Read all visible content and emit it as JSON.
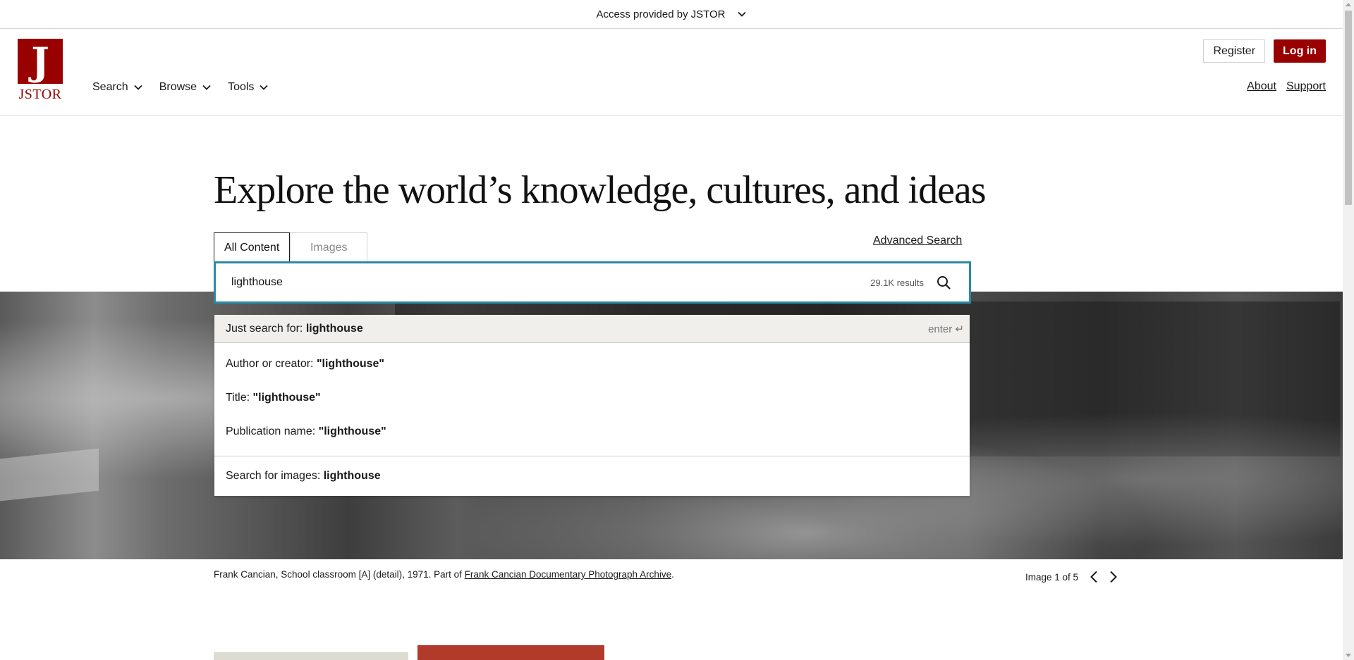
{
  "access": {
    "prefix": "Access provided by",
    "provider": "JSTOR"
  },
  "logo": {
    "mark": "J",
    "word": "JSTOR"
  },
  "nav": {
    "items": [
      {
        "label": "Search"
      },
      {
        "label": "Browse"
      },
      {
        "label": "Tools"
      }
    ]
  },
  "header": {
    "register_label": "Register",
    "login_label": "Log in",
    "about_label": "About",
    "support_label": "Support"
  },
  "hero": {
    "title": "Explore the world’s knowledge, cultures, and ideas"
  },
  "tabs": [
    {
      "label": "All Content",
      "active": true
    },
    {
      "label": "Images",
      "active": false
    }
  ],
  "advanced_search_label": "Advanced Search",
  "search": {
    "value": "lighthouse",
    "result_count": "29.1K results"
  },
  "dropdown": {
    "first": {
      "prefix": "Just search for:",
      "term": "lighthouse",
      "hint": "enter ↵"
    },
    "items": [
      {
        "prefix": "Author or creator:",
        "term": "\"lighthouse\""
      },
      {
        "prefix": "Title:",
        "term": "\"lighthouse\""
      },
      {
        "prefix": "Publication name:",
        "term": "\"lighthouse\""
      }
    ],
    "last": {
      "prefix": "Search for images:",
      "term": "lighthouse"
    }
  },
  "caption": {
    "text": "Frank Cancian, School classroom [A] (detail), 1971. Part of",
    "link": "Frank Cancian Documentary Photograph Archive",
    "suffix": "."
  },
  "image_nav": {
    "label": "Image 1 of 5"
  },
  "colors": {
    "brand": "#990000",
    "focus": "#2b8aa6"
  }
}
